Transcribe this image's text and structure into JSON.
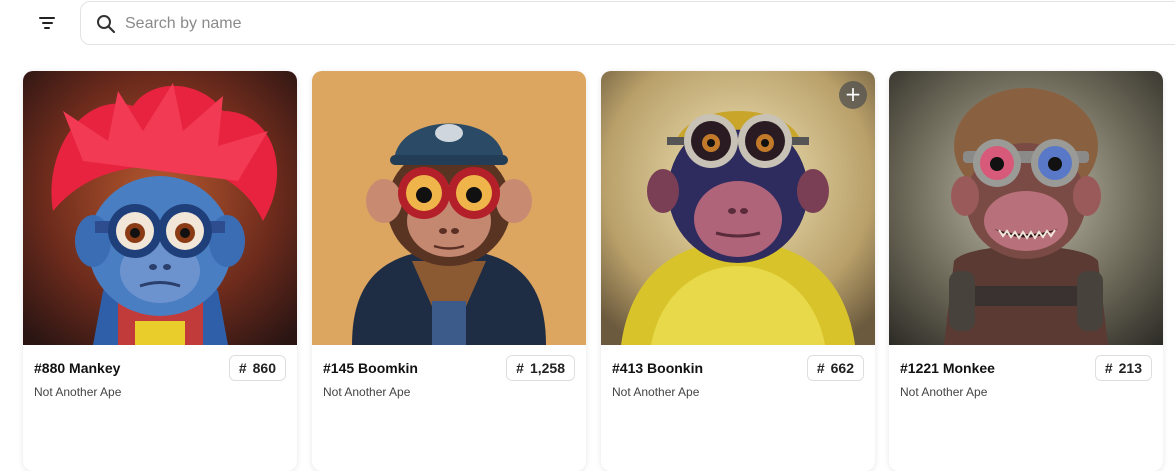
{
  "search": {
    "placeholder": "Search by name",
    "value": ""
  },
  "icons": {
    "filter": "filter-icon",
    "search": "search-icon",
    "add": "plus-icon"
  },
  "cards": [
    {
      "title": "#880 Mankey",
      "collection": "Not Another Ape",
      "rank_prefix": "#",
      "rank": "860"
    },
    {
      "title": "#145 Boomkin",
      "collection": "Not Another Ape",
      "rank_prefix": "#",
      "rank": "1,258"
    },
    {
      "title": "#413 Boonkin",
      "collection": "Not Another Ape",
      "rank_prefix": "#",
      "rank": "662",
      "add_button": "+"
    },
    {
      "title": "#1221 Monkee",
      "collection": "Not Another Ape",
      "rank_prefix": "#",
      "rank": "213"
    }
  ]
}
